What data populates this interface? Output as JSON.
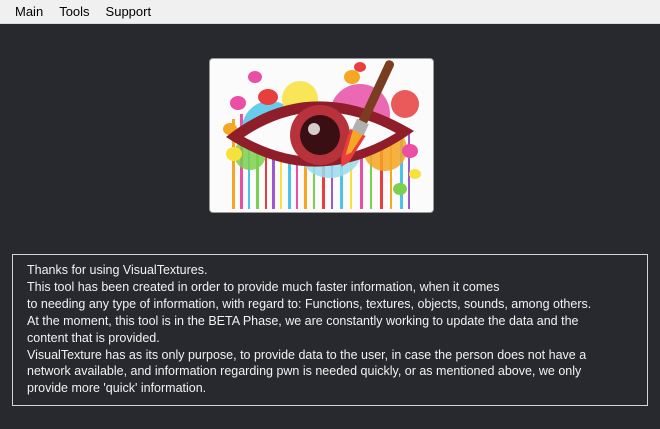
{
  "menu": {
    "items": [
      "Main",
      "Tools",
      "Support"
    ]
  },
  "logo": {
    "icon": "eye-paintbrush-logo",
    "colors": {
      "eye": "#8f1d2a",
      "brush": "#7a3d1f",
      "splash": [
        "#e83e3e",
        "#f5a623",
        "#f7e23b",
        "#4cc3e8",
        "#e84fa5",
        "#7bd04f",
        "#9b59d0"
      ]
    }
  },
  "info": {
    "lines": [
      "Thanks for using VisualTextures.",
      "This tool has been created in order to provide much faster information, when it comes",
      "to needing any type of information, with regard to: Functions, textures, objects, sounds, among others.",
      "At the moment, this tool is in the BETA Phase, we are constantly working to update the data and the",
      "content that is provided.",
      "VisualTexture has as its only purpose, to provide data to the user, in case the person does not have a",
      "network available, and information regarding pwn is needed quickly, or as mentioned above, we only",
      "provide more 'quick' information."
    ]
  },
  "theme": {
    "background": "#28292e",
    "menubar": "#f0f0f0",
    "panel_border": "#d4d4d4",
    "text": "#f2f2f2"
  }
}
